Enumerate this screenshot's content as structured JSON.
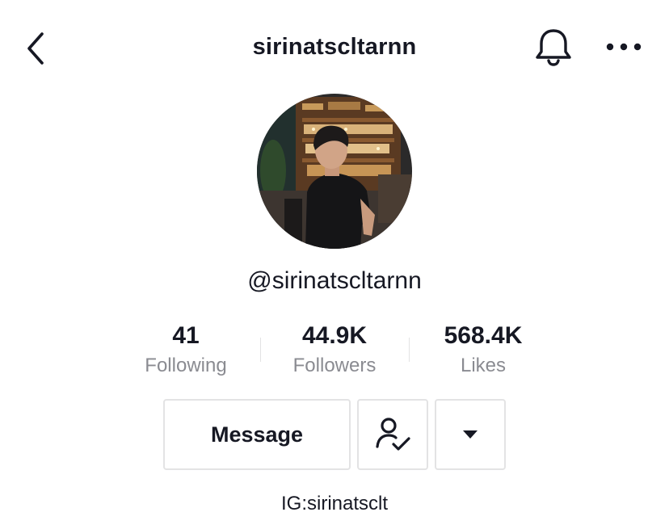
{
  "header": {
    "username": "sirinatscltarnn"
  },
  "profile": {
    "handle": "@sirinatscltarnn",
    "bio": "IG:sirinatsclt"
  },
  "stats": [
    {
      "value": "41",
      "label": "Following"
    },
    {
      "value": "44.9K",
      "label": "Followers"
    },
    {
      "value": "568.4K",
      "label": "Likes"
    }
  ],
  "actions": {
    "message_label": "Message"
  },
  "icons": {
    "back": "chevron-left-icon",
    "bell": "bell-icon",
    "more": "more-horizontal-icon",
    "friend": "user-check-icon",
    "dropdown": "caret-down-icon"
  },
  "colors": {
    "text_primary": "#161823",
    "text_secondary": "#8a8b91",
    "border": "#e3e3e4"
  }
}
